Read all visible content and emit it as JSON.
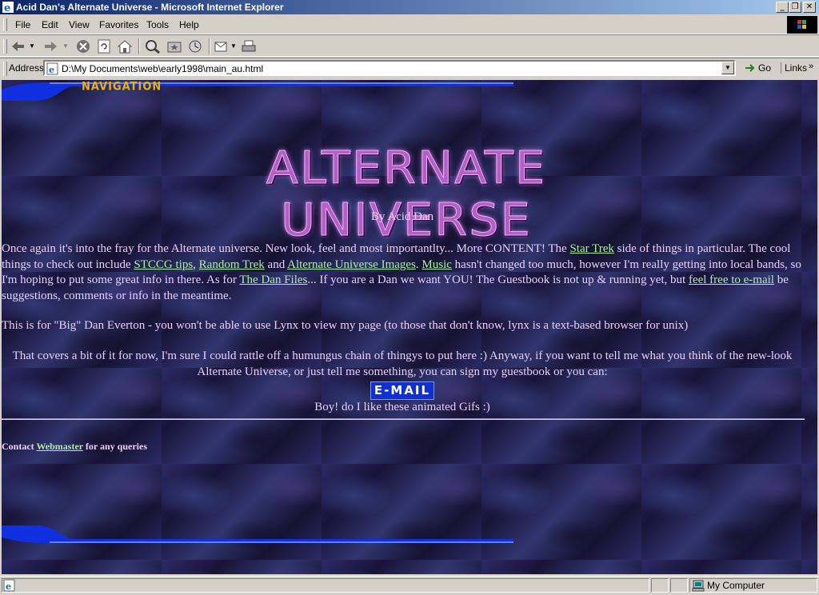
{
  "window": {
    "title": "Acid Dan's Alternate Universe - Microsoft Internet Explorer",
    "minimize_icon": "minimize-icon",
    "maximize_icon": "restore-icon",
    "close_icon": "close-icon"
  },
  "menu": {
    "items": [
      "File",
      "Edit",
      "View",
      "Favorites",
      "Tools",
      "Help"
    ]
  },
  "toolbar": {
    "buttons": [
      "back-icon",
      "forward-icon",
      "stop-icon",
      "refresh-icon",
      "home-icon",
      "search-icon",
      "favorites-icon",
      "history-icon",
      "mail-icon",
      "print-icon"
    ]
  },
  "address": {
    "label": "Address",
    "url": "D:\\My Documents\\web\\early1998\\main_au.html",
    "go_label": "Go",
    "links_label": "Links",
    "links_chevron": "»"
  },
  "page": {
    "nav_label": "NAVIGATION",
    "site_title": "ALTERNATE UNIVERSE",
    "byline": "By Acid Dan",
    "intro": {
      "t1": "Once again it's into the fray for the Alternate universe. New look, feel and most importantlty... More CONTENT! The ",
      "l1": "Star Trek",
      "t2": " side of things in particular. The cool things to check out include ",
      "l2": "STCCG tips",
      "t3": ", ",
      "l3": "Random Trek",
      "t4": " and ",
      "l4": "Alternate Universe Images",
      "t5": ". ",
      "l5": "Music",
      "t6": " hasn't changed too much, however I'm really getting into local bands, so I'm hoping to put some great info in there. As for ",
      "l6": "The Dan Files",
      "t7": "... If you are a Dan we want YOU! The Guestbook is not up & running yet, but ",
      "l7": "feel free to e-mail",
      "t8": " be suggestions, comments or info in the meantime."
    },
    "note": "This is for \"Big\" Dan Everton - you won't be able to use Lynx to view my page (to those that don't know, lynx is a text-based browser for unix)",
    "closing": "That covers a bit of it for now, I'm sure I could rattle off a humungus chain of thingys to put here :) Anyway, if you want to tell me what you think of the new-look Alternate Universe, or just tell me something, you can sign my guestbook or you can:",
    "email_button": "E-MAIL",
    "animated_note": "Boy! do I like these animated Gifs :)",
    "contact_pre": "Contact ",
    "contact_link": "Webmaster",
    "contact_post": " for any queries"
  },
  "status": {
    "zone": "My Computer",
    "zone_icon": "computer-icon",
    "page_icon": "ie-page-icon"
  },
  "colors": {
    "link": "#a8f0a0",
    "text": "#e8d0ff",
    "nav_label": "#f0b000",
    "title": "#b55ec8",
    "swoosh": "#1030e0"
  }
}
